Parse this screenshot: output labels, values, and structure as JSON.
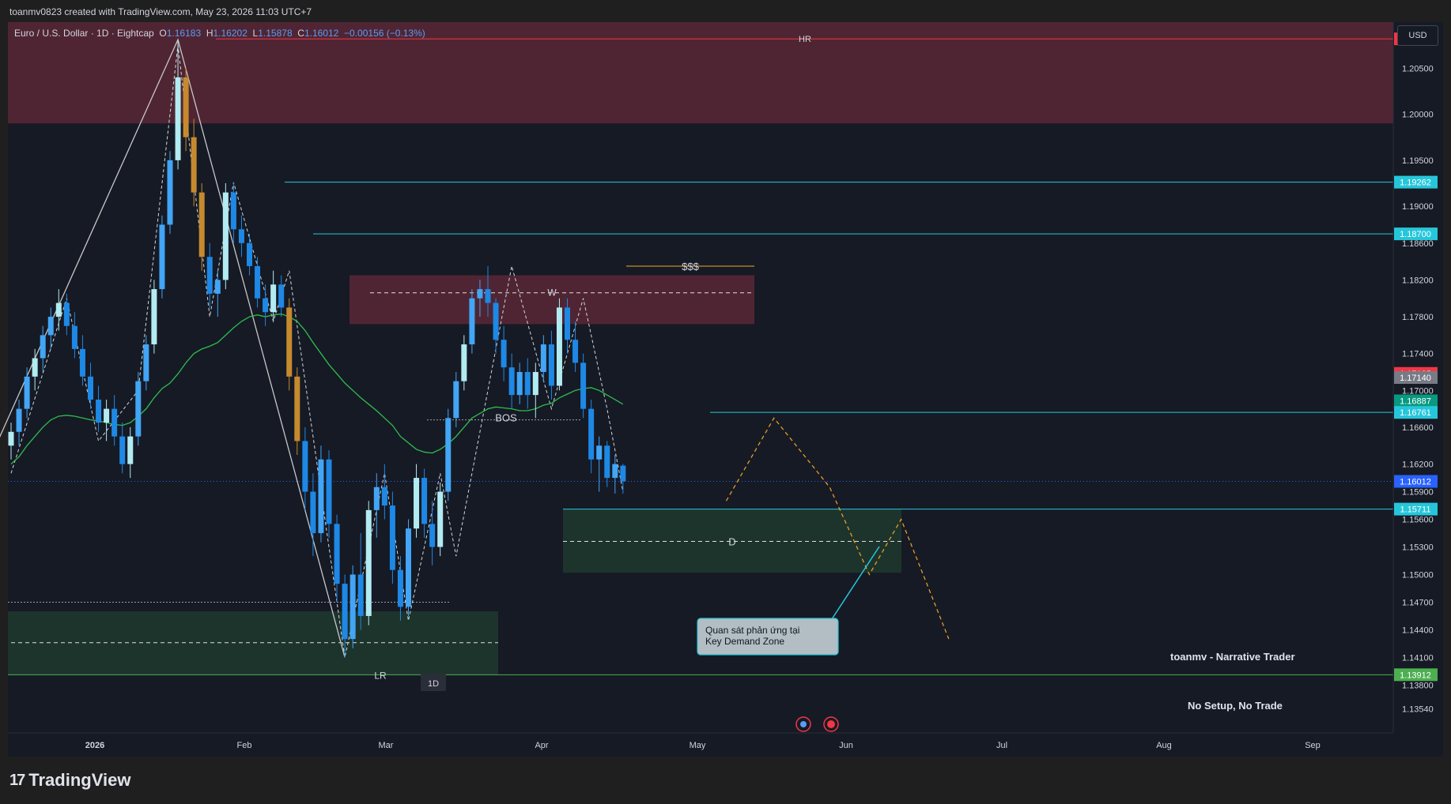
{
  "header": {
    "caption": "toanmv0823 created with TradingView.com, May 23, 2026 11:03 UTC+7"
  },
  "symbol": {
    "name": "Euro / U.S. Dollar · 1D · Eightcap",
    "o_label": "O",
    "o": "1.16183",
    "h_label": "H",
    "h": "1.16202",
    "l_label": "L",
    "l": "1.15878",
    "c_label": "C",
    "c": "1.16012",
    "change": "−0.00156 (−0.13%)"
  },
  "currency_button": "USD",
  "footer": {
    "logo_text": "TradingView",
    "logo_mark": "17"
  },
  "colors": {
    "bull": "#42a5f5",
    "bull_alt": "#b2ebf2",
    "bear": "#1e88e5",
    "gold": "#c68a2e",
    "ema": "#2ebd4e",
    "supply": "#5a2836",
    "demand": "#1e3a2e",
    "level_cyan": "#26c6da",
    "level_red": "#f23645",
    "level_green": "#4caf50",
    "fib_line": "#c7c7c7",
    "arrow": "#f5a623"
  },
  "chart_data": {
    "type": "candlestick",
    "x_ticks": [
      "2026",
      "Feb",
      "Mar",
      "Apr",
      "May",
      "Jun",
      "Jul",
      "Aug",
      "Sep"
    ],
    "y_ticks": [
      "1.20500",
      "1.20000",
      "1.19500",
      "1.19000",
      "1.18600",
      "1.18200",
      "1.17800",
      "1.17400",
      "1.17000",
      "1.16600",
      "1.16200",
      "1.15900",
      "1.15600",
      "1.15300",
      "1.15000",
      "1.14700",
      "1.14400",
      "1.14100",
      "1.13800",
      "1.13540"
    ],
    "y_range": [
      1.1328,
      1.21
    ],
    "price_labels": [
      {
        "value": "1.20818",
        "color": "#f23645"
      },
      {
        "value": "1.19262",
        "color": "#26c6da"
      },
      {
        "value": "1.18700",
        "color": "#26c6da"
      },
      {
        "value": "1.17185",
        "color": "#f23645"
      },
      {
        "value": "1.17140",
        "color": "#787b86"
      },
      {
        "value": "1.16887",
        "color": "#089981"
      },
      {
        "value": "1.16761",
        "color": "#26c6da"
      },
      {
        "value": "1.16012",
        "color": "#2962ff"
      },
      {
        "value": "1.15711",
        "color": "#26c6da"
      },
      {
        "value": "1.13912",
        "color": "#4caf50"
      }
    ],
    "levels": [
      {
        "label": "HR",
        "price": 1.20818
      },
      {
        "label": "W",
        "price": 1.1806
      },
      {
        "label": "$$$",
        "price": 1.1835
      },
      {
        "label": "BOS",
        "price": 1.16761
      },
      {
        "label": "D",
        "price": 1.1536
      },
      {
        "label": "LR",
        "price": 1.13912
      }
    ],
    "zones": [
      {
        "kind": "supply",
        "top": 1.21,
        "bottom": 1.199
      },
      {
        "kind": "supply",
        "top": 1.1825,
        "bottom": 1.1772
      },
      {
        "kind": "demand",
        "top": 1.1571,
        "bottom": 1.1502
      },
      {
        "kind": "demand",
        "top": 1.146,
        "bottom": 1.1391
      }
    ],
    "candles": [
      {
        "o": 1.164,
        "h": 1.1665,
        "l": 1.1625,
        "c": 1.1655
      },
      {
        "o": 1.1655,
        "h": 1.169,
        "l": 1.164,
        "c": 1.168
      },
      {
        "o": 1.168,
        "h": 1.1725,
        "l": 1.167,
        "c": 1.1715
      },
      {
        "o": 1.1715,
        "h": 1.1745,
        "l": 1.17,
        "c": 1.1735
      },
      {
        "o": 1.1735,
        "h": 1.177,
        "l": 1.172,
        "c": 1.176
      },
      {
        "o": 1.176,
        "h": 1.179,
        "l": 1.1745,
        "c": 1.178
      },
      {
        "o": 1.178,
        "h": 1.181,
        "l": 1.1765,
        "c": 1.1795
      },
      {
        "o": 1.1795,
        "h": 1.1805,
        "l": 1.176,
        "c": 1.177
      },
      {
        "o": 1.177,
        "h": 1.1785,
        "l": 1.1735,
        "c": 1.1745
      },
      {
        "o": 1.1745,
        "h": 1.176,
        "l": 1.1705,
        "c": 1.1715
      },
      {
        "o": 1.1715,
        "h": 1.173,
        "l": 1.168,
        "c": 1.169
      },
      {
        "o": 1.169,
        "h": 1.1705,
        "l": 1.1655,
        "c": 1.1665
      },
      {
        "o": 1.1665,
        "h": 1.169,
        "l": 1.1645,
        "c": 1.168
      },
      {
        "o": 1.168,
        "h": 1.1695,
        "l": 1.164,
        "c": 1.165
      },
      {
        "o": 1.165,
        "h": 1.1665,
        "l": 1.161,
        "c": 1.162
      },
      {
        "o": 1.162,
        "h": 1.166,
        "l": 1.1605,
        "c": 1.165
      },
      {
        "o": 1.165,
        "h": 1.172,
        "l": 1.164,
        "c": 1.171
      },
      {
        "o": 1.171,
        "h": 1.176,
        "l": 1.17,
        "c": 1.175
      },
      {
        "o": 1.175,
        "h": 1.182,
        "l": 1.174,
        "c": 1.181
      },
      {
        "o": 1.181,
        "h": 1.189,
        "l": 1.18,
        "c": 1.188
      },
      {
        "o": 1.188,
        "h": 1.196,
        "l": 1.187,
        "c": 1.195
      },
      {
        "o": 1.195,
        "h": 1.208,
        "l": 1.194,
        "c": 1.204
      },
      {
        "o": 1.204,
        "h": 1.205,
        "l": 1.196,
        "c": 1.1975
      },
      {
        "o": 1.1975,
        "h": 1.1995,
        "l": 1.19,
        "c": 1.1915
      },
      {
        "o": 1.1915,
        "h": 1.1925,
        "l": 1.183,
        "c": 1.1845
      },
      {
        "o": 1.1845,
        "h": 1.186,
        "l": 1.179,
        "c": 1.1805
      },
      {
        "o": 1.1805,
        "h": 1.183,
        "l": 1.178,
        "c": 1.182
      },
      {
        "o": 1.182,
        "h": 1.1925,
        "l": 1.181,
        "c": 1.1915
      },
      {
        "o": 1.1915,
        "h": 1.1926,
        "l": 1.186,
        "c": 1.1875
      },
      {
        "o": 1.1875,
        "h": 1.189,
        "l": 1.1845,
        "c": 1.186
      },
      {
        "o": 1.186,
        "h": 1.187,
        "l": 1.1825,
        "c": 1.1835
      },
      {
        "o": 1.1835,
        "h": 1.1845,
        "l": 1.179,
        "c": 1.18
      },
      {
        "o": 1.18,
        "h": 1.1815,
        "l": 1.177,
        "c": 1.1785
      },
      {
        "o": 1.1785,
        "h": 1.183,
        "l": 1.1775,
        "c": 1.1815
      },
      {
        "o": 1.1815,
        "h": 1.1825,
        "l": 1.178,
        "c": 1.179
      },
      {
        "o": 1.179,
        "h": 1.18,
        "l": 1.17,
        "c": 1.1715
      },
      {
        "o": 1.1715,
        "h": 1.1725,
        "l": 1.163,
        "c": 1.1645
      },
      {
        "o": 1.1645,
        "h": 1.166,
        "l": 1.157,
        "c": 1.159
      },
      {
        "o": 1.159,
        "h": 1.161,
        "l": 1.152,
        "c": 1.1545
      },
      {
        "o": 1.1545,
        "h": 1.164,
        "l": 1.1535,
        "c": 1.1625
      },
      {
        "o": 1.1625,
        "h": 1.1635,
        "l": 1.154,
        "c": 1.1555
      },
      {
        "o": 1.1555,
        "h": 1.1565,
        "l": 1.147,
        "c": 1.149
      },
      {
        "o": 1.149,
        "h": 1.15,
        "l": 1.141,
        "c": 1.143
      },
      {
        "o": 1.143,
        "h": 1.151,
        "l": 1.142,
        "c": 1.15
      },
      {
        "o": 1.15,
        "h": 1.1545,
        "l": 1.144,
        "c": 1.1455
      },
      {
        "o": 1.1455,
        "h": 1.158,
        "l": 1.1445,
        "c": 1.157
      },
      {
        "o": 1.157,
        "h": 1.161,
        "l": 1.154,
        "c": 1.1595
      },
      {
        "o": 1.1595,
        "h": 1.162,
        "l": 1.156,
        "c": 1.1575
      },
      {
        "o": 1.1575,
        "h": 1.159,
        "l": 1.149,
        "c": 1.1505
      },
      {
        "o": 1.1505,
        "h": 1.152,
        "l": 1.145,
        "c": 1.1465
      },
      {
        "o": 1.1465,
        "h": 1.156,
        "l": 1.1455,
        "c": 1.155
      },
      {
        "o": 1.155,
        "h": 1.162,
        "l": 1.154,
        "c": 1.1605
      },
      {
        "o": 1.1605,
        "h": 1.1615,
        "l": 1.154,
        "c": 1.1555
      },
      {
        "o": 1.1555,
        "h": 1.158,
        "l": 1.151,
        "c": 1.153
      },
      {
        "o": 1.153,
        "h": 1.16,
        "l": 1.152,
        "c": 1.159
      },
      {
        "o": 1.159,
        "h": 1.168,
        "l": 1.158,
        "c": 1.167
      },
      {
        "o": 1.167,
        "h": 1.172,
        "l": 1.166,
        "c": 1.171
      },
      {
        "o": 1.171,
        "h": 1.176,
        "l": 1.17,
        "c": 1.175
      },
      {
        "o": 1.175,
        "h": 1.181,
        "l": 1.174,
        "c": 1.18
      },
      {
        "o": 1.18,
        "h": 1.182,
        "l": 1.178,
        "c": 1.181
      },
      {
        "o": 1.181,
        "h": 1.1835,
        "l": 1.178,
        "c": 1.1795
      },
      {
        "o": 1.1795,
        "h": 1.18,
        "l": 1.174,
        "c": 1.1755
      },
      {
        "o": 1.1755,
        "h": 1.177,
        "l": 1.171,
        "c": 1.1725
      },
      {
        "o": 1.1725,
        "h": 1.174,
        "l": 1.168,
        "c": 1.1695
      },
      {
        "o": 1.1695,
        "h": 1.173,
        "l": 1.1685,
        "c": 1.172
      },
      {
        "o": 1.172,
        "h": 1.1735,
        "l": 1.168,
        "c": 1.1695
      },
      {
        "o": 1.1695,
        "h": 1.173,
        "l": 1.167,
        "c": 1.172
      },
      {
        "o": 1.172,
        "h": 1.176,
        "l": 1.171,
        "c": 1.175
      },
      {
        "o": 1.175,
        "h": 1.1765,
        "l": 1.169,
        "c": 1.1705
      },
      {
        "o": 1.1705,
        "h": 1.18,
        "l": 1.17,
        "c": 1.179
      },
      {
        "o": 1.179,
        "h": 1.18,
        "l": 1.174,
        "c": 1.1755
      },
      {
        "o": 1.1755,
        "h": 1.1775,
        "l": 1.172,
        "c": 1.173
      },
      {
        "o": 1.173,
        "h": 1.174,
        "l": 1.167,
        "c": 1.168
      },
      {
        "o": 1.168,
        "h": 1.169,
        "l": 1.161,
        "c": 1.1625
      },
      {
        "o": 1.1625,
        "h": 1.165,
        "l": 1.159,
        "c": 1.164
      },
      {
        "o": 1.164,
        "h": 1.1645,
        "l": 1.1595,
        "c": 1.1605
      },
      {
        "o": 1.1605,
        "h": 1.163,
        "l": 1.1588,
        "c": 1.162
      },
      {
        "o": 1.16183,
        "h": 1.16202,
        "l": 1.15878,
        "c": 1.16012
      }
    ],
    "ema": [
      1.162,
      1.1628,
      1.164,
      1.165,
      1.166,
      1.1668,
      1.1672,
      1.1673,
      1.1672,
      1.167,
      1.1668,
      1.1667,
      1.1665,
      1.1663,
      1.1662,
      1.1665,
      1.1672,
      1.168,
      1.1692,
      1.1702,
      1.1708,
      1.1718,
      1.173,
      1.174,
      1.1745,
      1.1748,
      1.1752,
      1.176,
      1.1768,
      1.1775,
      1.178,
      1.1782,
      1.178,
      1.1782,
      1.1783,
      1.178,
      1.1775,
      1.1765,
      1.1752,
      1.174,
      1.1728,
      1.1718,
      1.1708,
      1.17,
      1.1692,
      1.1685,
      1.1678,
      1.167,
      1.1662,
      1.165,
      1.1643,
      1.1636,
      1.1633,
      1.1632,
      1.1636,
      1.1642,
      1.165,
      1.166,
      1.167,
      1.1675,
      1.168,
      1.1682,
      1.1681,
      1.168,
      1.1678,
      1.1678,
      1.168,
      1.1684,
      1.1686,
      1.1692,
      1.1696,
      1.17,
      1.1702,
      1.1703,
      1.17,
      1.1695,
      1.169,
      1.1685
    ],
    "zigzag": [
      [
        0,
        1.161
      ],
      [
        7,
        1.18
      ],
      [
        11,
        1.1645
      ],
      [
        16,
        1.17
      ],
      [
        21,
        1.2075
      ],
      [
        25,
        1.178
      ],
      [
        28,
        1.1926
      ],
      [
        33,
        1.1775
      ],
      [
        35,
        1.183
      ],
      [
        42,
        1.141
      ],
      [
        47,
        1.161
      ],
      [
        50,
        1.145
      ],
      [
        54,
        1.161
      ],
      [
        56,
        1.152
      ],
      [
        63,
        1.1835
      ],
      [
        68,
        1.168
      ],
      [
        72,
        1.18
      ],
      [
        75,
        1.168
      ],
      [
        77,
        1.159
      ]
    ],
    "triangle": [
      [
        -4,
        1.16
      ],
      [
        21,
        1.2081
      ],
      [
        42,
        1.141
      ]
    ],
    "projection": [
      [
        90,
        1.158
      ],
      [
        96,
        1.167
      ],
      [
        103,
        1.1595
      ],
      [
        108,
        1.15
      ],
      [
        112,
        1.156
      ],
      [
        118,
        1.143
      ]
    ],
    "texts": {
      "hr": "HR",
      "w": "W",
      "liq": "$$$",
      "bos": "BOS",
      "d": "D",
      "lr": "LR",
      "tf": "1D",
      "callout_1": "Quan sát phản ứng tại",
      "callout_2": "Key Demand Zone",
      "author": "toanmv - Narrative Trader",
      "motto": "No Setup, No Trade"
    }
  }
}
